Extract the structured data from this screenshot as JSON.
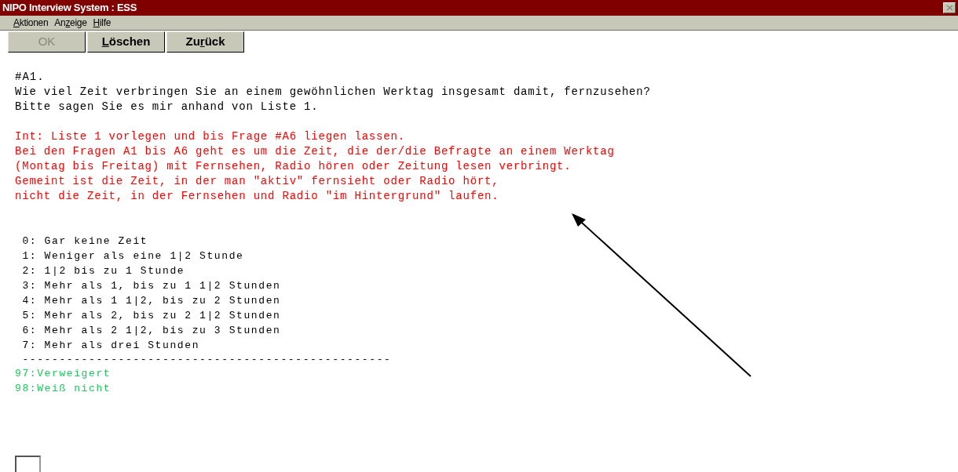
{
  "window": {
    "title": "NIPO Interview System : ESS"
  },
  "menu": [
    {
      "key": "A",
      "after": "ktionen"
    },
    {
      "before": "An",
      "key": "z",
      "after": "eige"
    },
    {
      "key": "H",
      "after": "ilfe"
    }
  ],
  "buttons": [
    {
      "before": "OK",
      "disabled": true
    },
    {
      "key": "L",
      "after": "öschen",
      "disabled": false
    },
    {
      "before": "Zu",
      "key": "r",
      "after": "ück",
      "disabled": false
    }
  ],
  "question": {
    "code": "#A1.",
    "lines": [
      "Wie viel Zeit verbringen Sie an einem gewöhnlichen Werktag insgesamt damit, fernzusehen?",
      "Bitte sagen Sie es mir anhand von Liste 1."
    ]
  },
  "instructions": [
    "Int: Liste 1 vorlegen und bis Frage #A6 liegen lassen.",
    "Bei den Fragen A1 bis A6 geht es um die Zeit, die der/die Befragte an einem Werktag",
    "(Montag bis Freitag) mit Fernsehen, Radio hören oder Zeitung lesen verbringt.",
    "Gemeint ist die Zeit, in der man \"aktiv\" fernsieht oder Radio hört,",
    "nicht die Zeit, in der Fernsehen und Radio \"im Hintergrund\" laufen."
  ],
  "answers": [
    " 0: Gar keine Zeit",
    " 1: Weniger als eine 1|2 Stunde",
    " 2: 1|2 bis zu 1 Stunde",
    " 3: Mehr als 1, bis zu 1 1|2 Stunden",
    " 4: Mehr als 1 1|2, bis zu 2 Stunden",
    " 5: Mehr als 2, bis zu 2 1|2 Stunden",
    " 6: Mehr als 2 1|2, bis zu 3 Stunden",
    " 7: Mehr als drei Stunden"
  ],
  "separator": " --------------------------------------------------",
  "special_answers": [
    "97:Verweigert",
    "98:Weiß nicht"
  ]
}
